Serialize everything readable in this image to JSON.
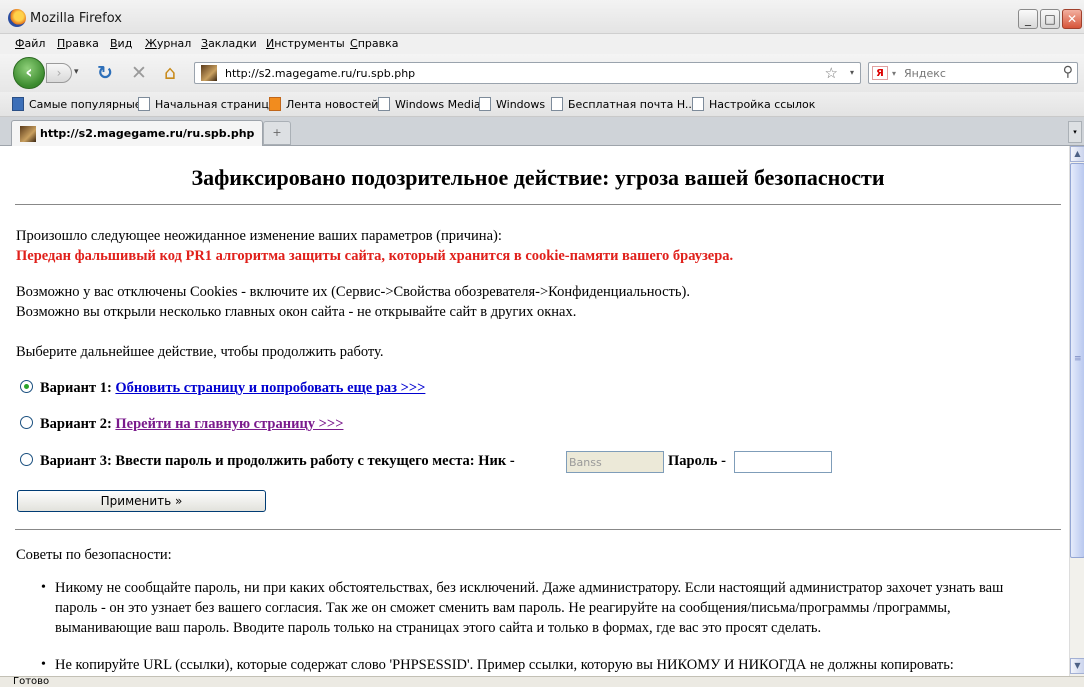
{
  "window": {
    "title": "Mozilla Firefox",
    "min": "_",
    "max": "□",
    "close": "✕"
  },
  "menu": [
    "Файл",
    "Правка",
    "Вид",
    "Журнал",
    "Закладки",
    "Инструменты",
    "Справка"
  ],
  "nav": {
    "back": "‹",
    "forward": "›",
    "history_dropdown": "▾",
    "reload": "↻",
    "stop": "✕",
    "home": "⌂",
    "url": "http://s2.magegame.ru/ru.spb.php",
    "bookmark_star": "☆",
    "url_dropdown": "▾",
    "search_engine": "Я",
    "search_dropdown": "▾",
    "search_placeholder": "Яндекс",
    "search_icon": "⚲"
  },
  "bookmarks": [
    "Самые популярные",
    "Начальная страница",
    "Лента новостей",
    "Windows Media",
    "Windows",
    "Бесплатная почта H...",
    "Настройка ссылок"
  ],
  "tabs": {
    "active": "http://s2.magegame.ru/ru.spb.php",
    "new_tab": "+",
    "list": "▾"
  },
  "page": {
    "heading": "Зафиксировано подозрительное действие: угроза вашей безопасности",
    "reason_intro": "Произошло следующее неожиданное изменение ваших параметров (причина):",
    "reason": "Передан фальшивый код PR1 алгоритма защиты сайта, который хранится в cookie-памяти вашего браузера.",
    "hint1": "Возможно у вас отключены Cookies - включите их (Сервис->Свойства обозревателя->Конфиденциальность).",
    "hint2": "Возможно вы открыли несколько главных окон сайта - не открывайте сайт в других окнах.",
    "choose": "Выберите дальнейшее действие, чтобы продолжить работу.",
    "option1_label": "Вариант 1:",
    "option1_link": "Обновить страницу и попробовать еще раз >>>",
    "option2_label": "Вариант 2:",
    "option2_link": "Перейти на главную страницу >>>",
    "option3_label": "Вариант 3: Ввести пароль и продолжить работу с текущего места: Ник -",
    "nick_value": "Banss",
    "password_label": "Пароль -",
    "password_value": "",
    "apply_button": "Применить »",
    "tips_title": "Советы по безопасности:",
    "tips": [
      "Никому не сообщайте пароль, ни при каких обстоятельствах, без исключений. Даже администратору. Если настоящий администратор захочет узнать ваш пароль - он это узнает без вашего согласия. Так же он сможет сменить вам пароль. Не реагируйте на сообщения/письма/программы /программы, выманивающие ваш пароль. Вводите пароль только на страницах этого сайта и только в формах, где вас это просят сделать.",
      "Не копируйте URL (ссылки), которые содержат слово 'PHPSESSID'. Пример ссылки, которую вы НИКОМУ И НИКОГДА не должны копировать:"
    ]
  },
  "scroll": {
    "up": "▲",
    "down": "▼"
  },
  "status": "Готово"
}
